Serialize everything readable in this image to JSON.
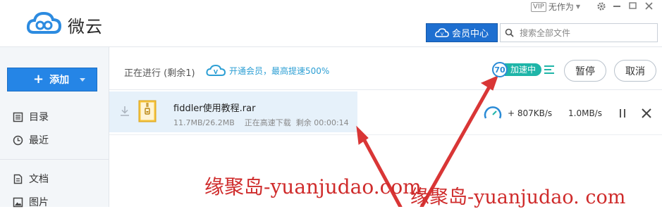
{
  "app": {
    "name": "微云"
  },
  "header": {
    "vip_badge": "VIP",
    "user_name": "无作为",
    "member_center_label": "会员中心",
    "search_placeholder": "搜索全部文件"
  },
  "sidebar": {
    "add_label": "添加",
    "items": [
      {
        "label": "目录",
        "icon": "catalog-icon"
      },
      {
        "label": "最近",
        "icon": "clock-icon"
      },
      {
        "label": "文档",
        "icon": "document-icon"
      },
      {
        "label": "图片",
        "icon": "image-icon"
      }
    ]
  },
  "transfer": {
    "status_text": "正在进行 (剩余1)",
    "vip_promo": "开通会员，最高提速500%",
    "accel_score": "70",
    "accel_label": "加速中",
    "pause_label": "暂停",
    "cancel_label": "取消",
    "items": [
      {
        "file_name": "fiddler使用教程.rar",
        "size_progress": "11.7MB/26.2MB",
        "state": "正在高速下载",
        "remaining": "剩余 00:00:14",
        "speed_boost": "+ 807KB/s",
        "speed_total": "1.0MB/s"
      }
    ]
  },
  "watermarks": {
    "left": "缘聚岛-yuanjudao.com",
    "right": "缘聚岛-yuanjudao. com"
  },
  "colors": {
    "primary_blue": "#2585e6",
    "member_blue": "#1e6fd0",
    "accel_teal": "#1fb5a8",
    "annotation_red": "#d93636",
    "highlight_row": "#e6f1fa"
  }
}
